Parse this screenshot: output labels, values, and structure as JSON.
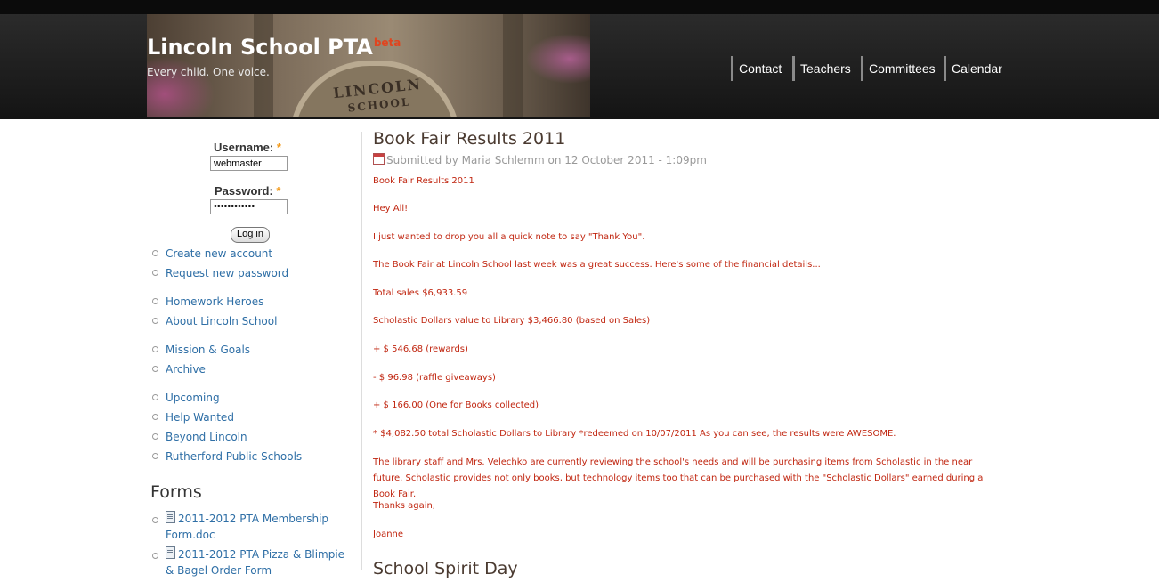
{
  "header": {
    "site_name": "Lincoln School PTA",
    "beta": "beta",
    "slogan": "Every child. One voice.",
    "banner_text_line1": "LINCOLN",
    "banner_text_line2": "SCHOOL"
  },
  "nav": {
    "items": [
      "Contact",
      "Teachers",
      "Committees",
      "Calendar"
    ]
  },
  "login": {
    "username_label": "Username:",
    "password_label": "Password:",
    "required_mark": "*",
    "username_value": "webmaster",
    "password_value": "••••••••••••",
    "button_label": "Log in"
  },
  "sidebar": {
    "account_links": [
      "Create new account",
      "Request new password"
    ],
    "group1": [
      "Homework Heroes",
      "About Lincoln School"
    ],
    "group2": [
      "Mission & Goals",
      "Archive"
    ],
    "group3": [
      "Upcoming",
      "Help Wanted",
      "Beyond Lincoln",
      "Rutherford Public Schools"
    ],
    "forms_title": "Forms",
    "forms": [
      "2011-2012 PTA Membership Form.doc",
      "2011-2012 PTA Pizza & Blimpie & Bagel Order Form"
    ]
  },
  "article": {
    "title": "Book Fair Results 2011",
    "submitted": "Submitted by Maria Schlemm on 12 October 2011 - 1:09pm",
    "paragraphs": [
      "Book Fair Results 2011",
      "Hey All!",
      "I just wanted to drop you all a quick note to say \"Thank You\".",
      "The Book Fair at Lincoln School last week was a great success. Here's some of the financial details...",
      "Total sales $6,933.59",
      "Scholastic Dollars value to Library $3,466.80 (based on Sales)",
      "+ $ 546.68 (rewards)",
      "- $ 96.98 (raffle giveaways)",
      "+ $ 166.00 (One for Books collected)",
      "* $4,082.50 total Scholastic Dollars to Library *redeemed on 10/07/2011 As you can see, the results were AWESOME.",
      "The library staff and Mrs. Velechko are currently reviewing the school's needs and will be purchasing items from Scholastic in the near future. Scholastic provides not only books, but technology items too that can be purchased with the \"Scholastic Dollars\" earned during a Book Fair.",
      "Thanks again,",
      "Joanne"
    ],
    "next_title": "School Spirit Day"
  },
  "colors": {
    "header_bg": "#1e1e1e",
    "link": "#2f6fa6",
    "body_text": "#c0250f",
    "beta": "#e0451f",
    "required": "#f39a1a"
  }
}
